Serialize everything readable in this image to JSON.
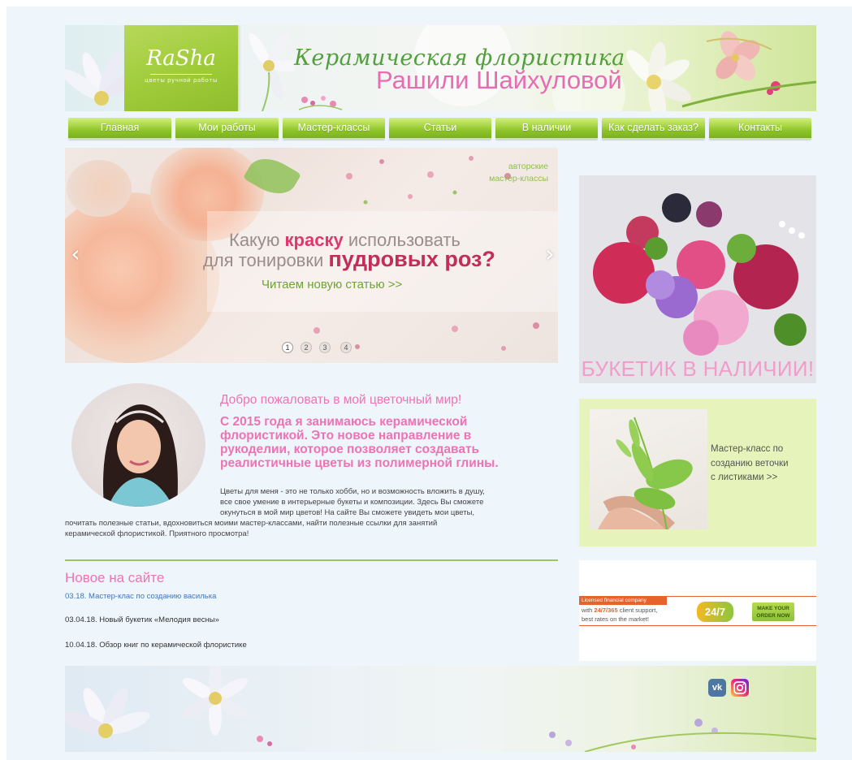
{
  "header": {
    "logo_text": "RaSha",
    "logo_subtitle": "цветы ручной работы",
    "title_script": "Керамическая флористика",
    "title_name": "Рашили Шайхуловой"
  },
  "nav": {
    "items": [
      {
        "label": "Главная"
      },
      {
        "label": "Мои работы"
      },
      {
        "label": "Мастер-классы"
      },
      {
        "label": "Статьи"
      },
      {
        "label": "В наличии"
      },
      {
        "label": "Как сделать заказ?"
      },
      {
        "label": "Контакты"
      }
    ]
  },
  "slider": {
    "tag_line1": "авторские",
    "tag_line2": "мастер-классы",
    "line1_a": "Какую ",
    "line1_b": "краску",
    "line1_c": " использовать",
    "line2_a": "для тонировки ",
    "line2_b": "пудровых роз?",
    "line3": "Читаем новую статью >>",
    "prev_arrow": "‹",
    "next_arrow": "›",
    "dots": [
      "1",
      "2",
      "3",
      "4"
    ],
    "active_dot": 1
  },
  "welcome": {
    "title": "Добро пожаловать в мой цветочный мир!",
    "lead": [
      "С 2015 года я занимаюсь керамической",
      "флористикой. Это новое направление в",
      "рукоделии, которое позволяет создавать",
      "реалистичные цветы из полимерной глины."
    ],
    "body": [
      "Цветы для меня - это не только хобби, но и возможность вложить в душу,",
      "все свое умение в интерьерные букеты и композиции. Здесь Вы сможете",
      "окунуться в мой мир цветов! На сайте Вы сможете увидеть мои цветы,",
      "почитать полезные статьи, вдохновиться моими мастер-классами, найти полезные ссылки для занятий",
      "керамической флористикой. Приятного просмотра!"
    ]
  },
  "news": {
    "title": "Новое на сайте",
    "items": [
      "03.18. Мастер-клас по созданию василька",
      "03.04.18. Новый букетик «Мелодия весны»",
      "10.04.18. Обзор книг по керамической флористике"
    ]
  },
  "sidebar": {
    "promo_label": "БУКЕТИК В НАЛИЧИИ!",
    "mk_lines": [
      "Мастер-класс по",
      "созданию веточки",
      "с листиками >>"
    ],
    "ad": {
      "badge": "Licensed financial company",
      "line1_a": "with ",
      "line1_b": "24/7/365",
      "line1_c": " client support,",
      "line2": "best rates on the market!",
      "logo": "24/7",
      "button": "MAKE YOUR ORDER NOW"
    }
  },
  "footer": {
    "vk_label": "vk",
    "instagram_icon": "instagram-icon"
  },
  "colors": {
    "accent_pink": "#ee73b5",
    "accent_green": "#8cc229",
    "link_blue": "#3a78c0"
  }
}
